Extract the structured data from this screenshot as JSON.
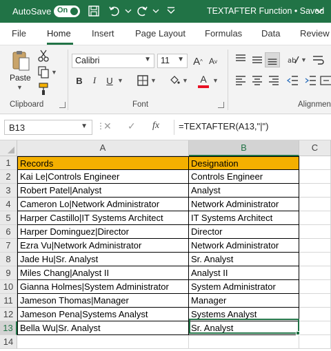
{
  "titlebar": {
    "autosave_label": "AutoSave",
    "autosave_state": "On",
    "doc_title": "TEXTAFTER Function • Saved",
    "icons": [
      "save-icon",
      "undo-icon",
      "redo-icon",
      "more-icon"
    ]
  },
  "tabs": [
    "File",
    "Home",
    "Insert",
    "Page Layout",
    "Formulas",
    "Data",
    "Review"
  ],
  "active_tab": "Home",
  "ribbon": {
    "paste_label": "Paste",
    "clipboard_label": "Clipboard",
    "font_label": "Font",
    "alignment_label": "Alignmen",
    "font_name": "Calibri",
    "font_size": "11",
    "bold": "B",
    "italic": "I",
    "underline": "U",
    "font_color": "#e81123"
  },
  "formula_bar": {
    "name_box": "B13",
    "fx": "fx",
    "formula": "=TEXTAFTER(A13,\"|\")"
  },
  "columns": [
    "A",
    "B",
    "C"
  ],
  "rows": [
    {
      "num": "1",
      "a": "Records",
      "b": "Designation"
    },
    {
      "num": "2",
      "a": "Kai Le|Controls Engineer",
      "b": "Controls Engineer"
    },
    {
      "num": "3",
      "a": "Robert Patel|Analyst",
      "b": "Analyst"
    },
    {
      "num": "4",
      "a": "Cameron Lo|Network Administrator",
      "b": "Network Administrator"
    },
    {
      "num": "5",
      "a": "Harper Castillo|IT Systems Architect",
      "b": "IT Systems Architect"
    },
    {
      "num": "6",
      "a": "Harper Dominguez|Director",
      "b": "Director"
    },
    {
      "num": "7",
      "a": "Ezra Vu|Network Administrator",
      "b": "Network Administrator"
    },
    {
      "num": "8",
      "a": "Jade Hu|Sr. Analyst",
      "b": "Sr. Analyst"
    },
    {
      "num": "9",
      "a": "Miles Chang|Analyst II",
      "b": "Analyst II"
    },
    {
      "num": "10",
      "a": "Gianna Holmes|System Administrator",
      "b": "System Administrator"
    },
    {
      "num": "11",
      "a": "Jameson Thomas|Manager",
      "b": "Manager"
    },
    {
      "num": "12",
      "a": "Jameson Pena|Systems Analyst",
      "b": "Systems Analyst"
    },
    {
      "num": "13",
      "a": "Bella Wu|Sr. Analyst",
      "b": "Sr. Analyst"
    },
    {
      "num": "14",
      "a": "",
      "b": ""
    }
  ],
  "colors": {
    "brand": "#217346",
    "header_fill": "#f4b000"
  }
}
